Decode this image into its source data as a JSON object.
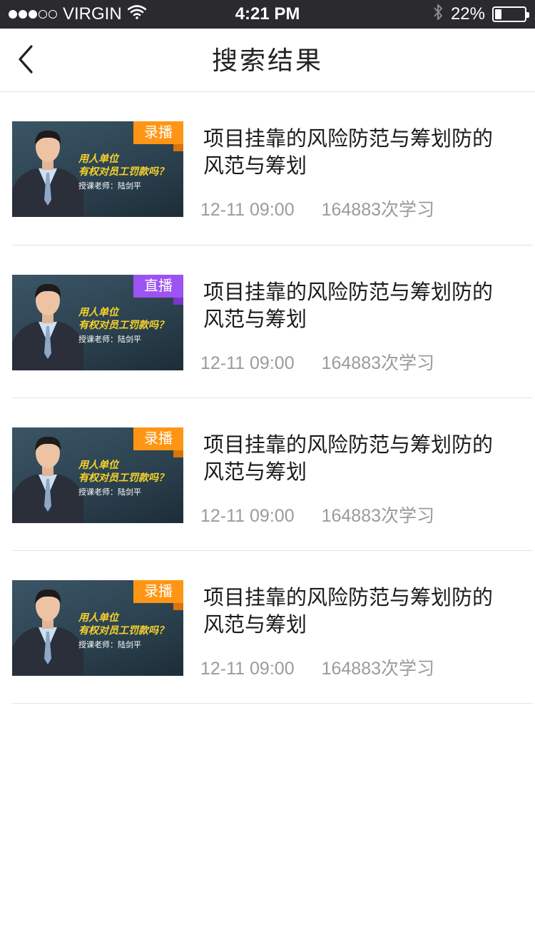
{
  "status_bar": {
    "carrier": "VIRGIN",
    "time": "4:21 PM",
    "battery_text": "22%",
    "battery_level": 0.22
  },
  "nav": {
    "title": "搜索结果"
  },
  "items": [
    {
      "badge": "录播",
      "badge_color": "#ff9514",
      "title": "项目挂靠的风险防范与筹划防的风范与筹划",
      "date": "12-11 09:00",
      "count": "164883次学习",
      "poster": {
        "line1": "用人单位",
        "line2": "有权对员工罚款吗？",
        "line3": "授课老师：陆剑平"
      }
    },
    {
      "badge": "直播",
      "badge_color": "#9d52f2",
      "title": "项目挂靠的风险防范与筹划防的风范与筹划",
      "date": "12-11 09:00",
      "count": "164883次学习",
      "poster": {
        "line1": "用人单位",
        "line2": "有权对员工罚款吗？",
        "line3": "授课老师：陆剑平"
      }
    },
    {
      "badge": "录播",
      "badge_color": "#ff9514",
      "title": "项目挂靠的风险防范与筹划防的风范与筹划",
      "date": "12-11 09:00",
      "count": "164883次学习",
      "poster": {
        "line1": "用人单位",
        "line2": "有权对员工罚款吗？",
        "line3": "授课老师：陆剑平"
      }
    },
    {
      "badge": "录播",
      "badge_color": "#ff9514",
      "title": "项目挂靠的风险防范与筹划防的风范与筹划",
      "date": "12-11 09:00",
      "count": "164883次学习",
      "poster": {
        "line1": "用人单位",
        "line2": "有权对员工罚款吗？",
        "line3": "授课老师：陆剑平"
      }
    }
  ],
  "icons": {
    "back": "chevron-left-icon",
    "wifi": "wifi-icon",
    "bluetooth": "bluetooth-icon",
    "battery": "battery-icon"
  }
}
